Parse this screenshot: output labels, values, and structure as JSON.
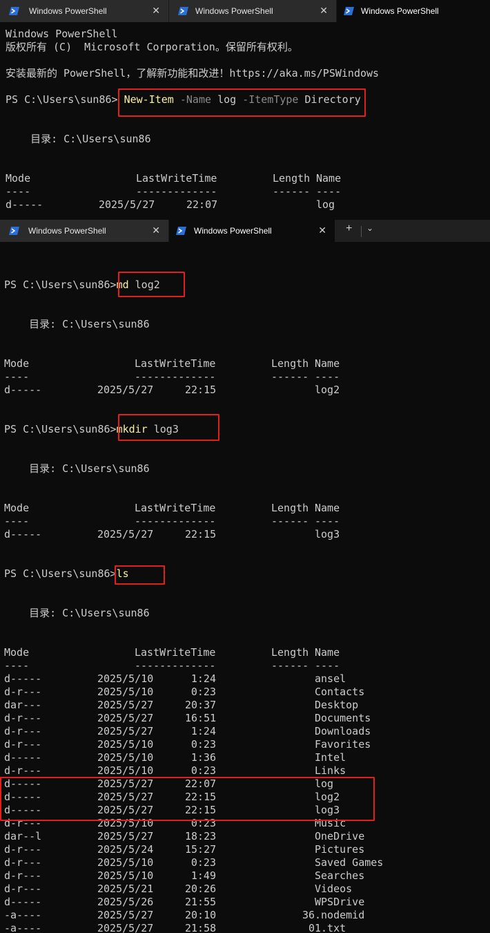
{
  "window_top": {
    "tabs": [
      {
        "label": "Windows PowerShell",
        "close": "✕",
        "active": false
      },
      {
        "label": "Windows PowerShell",
        "close": "✕",
        "active": false
      },
      {
        "label": "Windows PowerShell",
        "active": true
      }
    ],
    "banner": [
      "Windows PowerShell",
      "版权所有 (C)  Microsoft Corporation。保留所有权利。",
      "安装最新的 PowerShell，了解新功能和改进！https://aka.ms/PSWindows"
    ],
    "prompt": "PS C:\\Users\\sun86> ",
    "command": {
      "cmdlet": "New-Item",
      "p1": "-Name",
      "v1": "log",
      "p2": "-ItemType",
      "v2": "Directory"
    },
    "directory_label": "    目录: C:\\Users\\sun86",
    "headers": {
      "mode": "Mode",
      "lastwrite": "LastWriteTime",
      "length": "Length",
      "name": "Name"
    },
    "underline": {
      "mode": "----",
      "lastwrite": "-------------",
      "length": "------",
      "name": "----"
    },
    "rows": [
      {
        "mode": "d-----",
        "date": "2025/5/27",
        "time": "22:07",
        "length": "",
        "name": "log"
      }
    ]
  },
  "window_bottom": {
    "tabs": [
      {
        "label": "Windows PowerShell",
        "close": "✕",
        "active": false
      },
      {
        "label": "Windows PowerShell",
        "close": "✕",
        "active": true
      }
    ],
    "newtab": "+",
    "dropdown": "⌄",
    "prompt": "PS C:\\Users\\sun86>",
    "directory_label": "    目录: C:\\Users\\sun86",
    "headers": {
      "mode": "Mode",
      "lastwrite": "LastWriteTime",
      "length": "Length",
      "name": "Name"
    },
    "underline": {
      "mode": "----",
      "lastwrite": "-------------",
      "length": "------",
      "name": "----"
    },
    "blocks": [
      {
        "command": {
          "cmdlet": "md",
          "args": " log2"
        },
        "rows": [
          {
            "mode": "d-----",
            "date": "2025/5/27",
            "time": "22:15",
            "length": "",
            "name": "log2"
          }
        ]
      },
      {
        "command": {
          "cmdlet": "mkdir",
          "args": " log3"
        },
        "rows": [
          {
            "mode": "d-----",
            "date": "2025/5/27",
            "time": "22:15",
            "length": "",
            "name": "log3"
          }
        ]
      },
      {
        "command": {
          "cmdlet": "ls",
          "args": ""
        },
        "rows": [
          {
            "mode": "d-----",
            "date": "2025/5/10",
            "time": "1:24",
            "length": "",
            "name": "ansel"
          },
          {
            "mode": "d-r---",
            "date": "2025/5/10",
            "time": "0:23",
            "length": "",
            "name": "Contacts"
          },
          {
            "mode": "dar---",
            "date": "2025/5/27",
            "time": "20:37",
            "length": "",
            "name": "Desktop"
          },
          {
            "mode": "d-r---",
            "date": "2025/5/27",
            "time": "16:51",
            "length": "",
            "name": "Documents"
          },
          {
            "mode": "d-r---",
            "date": "2025/5/27",
            "time": "1:24",
            "length": "",
            "name": "Downloads"
          },
          {
            "mode": "d-r---",
            "date": "2025/5/10",
            "time": "0:23",
            "length": "",
            "name": "Favorites"
          },
          {
            "mode": "d-----",
            "date": "2025/5/10",
            "time": "1:36",
            "length": "",
            "name": "Intel"
          },
          {
            "mode": "d-r---",
            "date": "2025/5/10",
            "time": "0:23",
            "length": "",
            "name": "Links"
          },
          {
            "mode": "d-----",
            "date": "2025/5/27",
            "time": "22:07",
            "length": "",
            "name": "log"
          },
          {
            "mode": "d-----",
            "date": "2025/5/27",
            "time": "22:15",
            "length": "",
            "name": "log2"
          },
          {
            "mode": "d-----",
            "date": "2025/5/27",
            "time": "22:15",
            "length": "",
            "name": "log3"
          },
          {
            "mode": "d-r---",
            "date": "2025/5/10",
            "time": "0:23",
            "length": "",
            "name": "Music"
          },
          {
            "mode": "dar--l",
            "date": "2025/5/27",
            "time": "18:23",
            "length": "",
            "name": "OneDrive"
          },
          {
            "mode": "d-r---",
            "date": "2025/5/24",
            "time": "15:27",
            "length": "",
            "name": "Pictures"
          },
          {
            "mode": "d-r---",
            "date": "2025/5/10",
            "time": "0:23",
            "length": "",
            "name": "Saved Games"
          },
          {
            "mode": "d-r---",
            "date": "2025/5/10",
            "time": "1:49",
            "length": "",
            "name": "Searches"
          },
          {
            "mode": "d-r---",
            "date": "2025/5/21",
            "time": "20:26",
            "length": "",
            "name": "Videos"
          },
          {
            "mode": "d-----",
            "date": "2025/5/26",
            "time": "21:55",
            "length": "",
            "name": "WPSDrive"
          },
          {
            "mode": "-a----",
            "date": "2025/5/27",
            "time": "20:10",
            "length": "36",
            "name": ".nodemid"
          },
          {
            "mode": "-a----",
            "date": "2025/5/27",
            "time": "21:58",
            "length": "0",
            "name": "1.txt"
          }
        ]
      }
    ]
  },
  "colors": {
    "background": "#0c0c0c",
    "text": "#cccccc",
    "command": "#f9f1a5",
    "parameter": "#8a8a8a",
    "highlight_box": "#e21f1f"
  }
}
